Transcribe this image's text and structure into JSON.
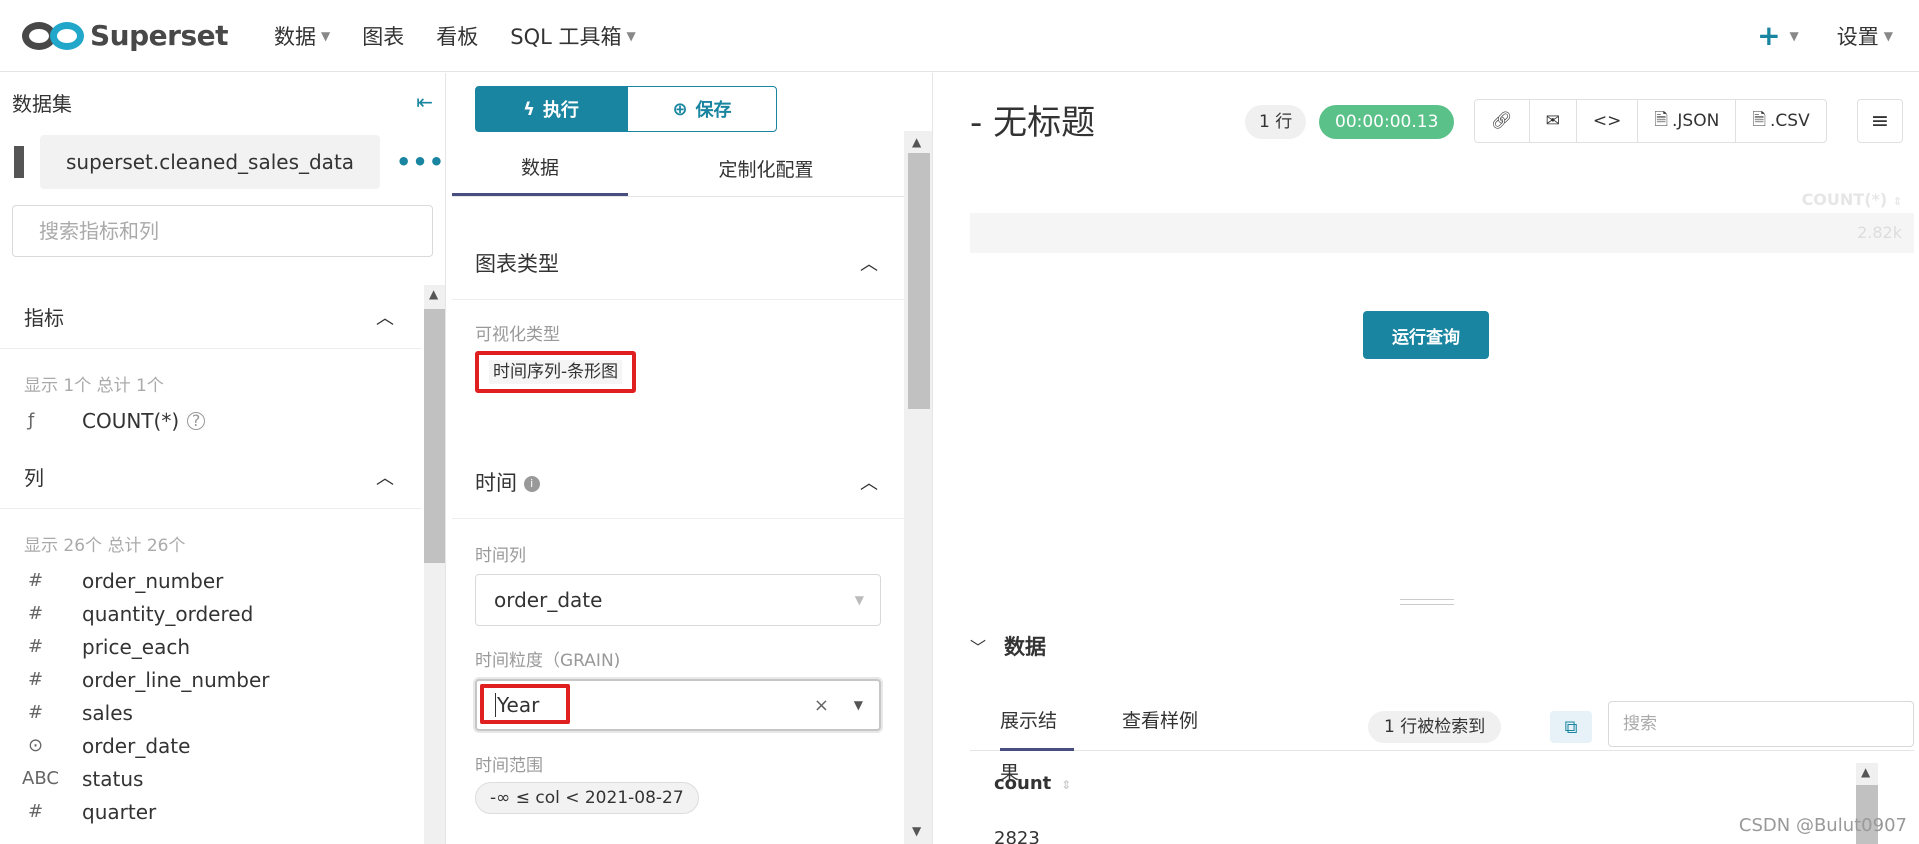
{
  "nav": {
    "brand": "Superset",
    "items": [
      {
        "label": "数据",
        "caret": true
      },
      {
        "label": "图表",
        "caret": false
      },
      {
        "label": "看板",
        "caret": false
      },
      {
        "label": "SQL 工具箱",
        "caret": true
      }
    ],
    "settings": "设置"
  },
  "left": {
    "title": "数据集",
    "dataset": "superset.cleaned_sales_data",
    "search_placeholder": "搜索指标和列",
    "metrics": {
      "title": "指标",
      "meta": "显示 1个 总计 1个",
      "items": [
        {
          "type": "ƒ",
          "name": "COUNT(*)"
        }
      ]
    },
    "columns": {
      "title": "列",
      "meta": "显示 26个 总计 26个",
      "items": [
        {
          "type": "#",
          "name": "order_number"
        },
        {
          "type": "#",
          "name": "quantity_ordered"
        },
        {
          "type": "#",
          "name": "price_each"
        },
        {
          "type": "#",
          "name": "order_line_number"
        },
        {
          "type": "#",
          "name": "sales"
        },
        {
          "type": "⊙",
          "name": "order_date"
        },
        {
          "type": "ABC",
          "name": "status"
        },
        {
          "type": "#",
          "name": "quarter"
        }
      ]
    }
  },
  "mid": {
    "run_label": "执行",
    "save_label": "保存",
    "tabs": [
      "数据",
      "定制化配置"
    ],
    "chart_type": {
      "title": "图表类型",
      "viz_label": "可视化类型",
      "viz_value": "时间序列-条形图"
    },
    "time": {
      "title": "时间",
      "col_label": "时间列",
      "col_value": "order_date",
      "grain_label": "时间粒度（GRAIN)",
      "grain_value": "Year",
      "range_label": "时间范围",
      "range_value": "-∞ ≤ col < 2021-08-27"
    }
  },
  "right": {
    "title": "- 无标题",
    "rows_badge": "1 行",
    "time_badge": "00:00:00.13",
    "tools": [
      ".JSON",
      ".CSV"
    ],
    "col_header": "COUNT(*)",
    "col_value": "2.82k",
    "run_query": "运行查询",
    "data_section": "数据",
    "tabs": [
      "展示结果",
      "查看样例"
    ],
    "found": "1 行被检索到",
    "search_placeholder": "搜索",
    "table_col": "count",
    "table_value": "2823"
  },
  "watermark": "CSDN @Bulut0907",
  "colors": {
    "primary": "#1a85a0",
    "success": "#5ac189",
    "highlight": "#e02020"
  }
}
